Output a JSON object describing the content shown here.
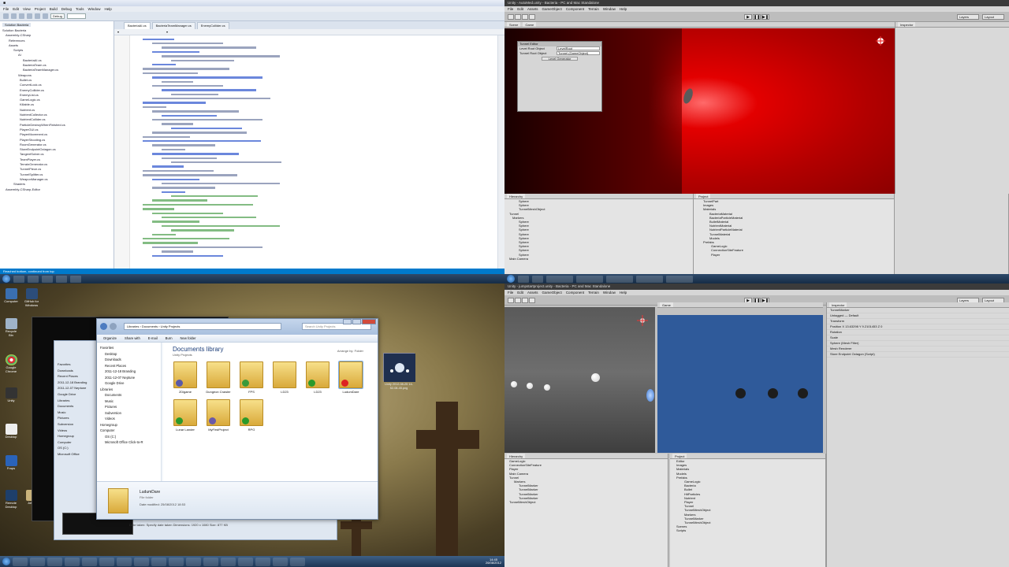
{
  "quadrants": {
    "visual_studio": {
      "solution_tabs": [
        "Solution Bacteria"
      ],
      "solution_tree": [
        "Solution Bacteria",
        "Assembly-CSharp",
        "References",
        "Assets",
        "Scripts",
        "AI",
        "BacteriaAI.cs",
        "BacteriaTeam.cs",
        "BacteriaTeamManager.cs",
        "Weapons",
        "Bullet.cs",
        "ConvertLock.cs",
        "EnemyCollider.cs",
        "EnemyList.cs",
        "GameLogic.cs",
        "Killable.cs",
        "Nutrient.cs",
        "NutrientCollector.cs",
        "NutrientCollider.cs",
        "ParticleDestroyWhenFinished.cs",
        "PlayerGUI.cs",
        "PlayerMovement.cs",
        "PlayerShooting.cs",
        "RoomGenerator.cs",
        "StoreEndpointOctagon.cs",
        "TangentSolver.cs",
        "TeamPlayer.cs",
        "TerrainGenerator.cs",
        "TunnelPiece.cs",
        "TunnelSplitter.cs",
        "WeaponManager.cs",
        "Shaders",
        "Assembly-CSharp-Editor"
      ],
      "editor_tabs": [
        "BacteriaAI.cs",
        "BacteriaTeamManager.cs",
        "EnemyCollider.cs"
      ],
      "status": "Reached bottom, continued from top"
    },
    "unity_game": {
      "title": "Unity - AutoMed.unity - Bacteria - PC and Mac Standalone",
      "menu": [
        "File",
        "Edit",
        "Assets",
        "GameObject",
        "Component",
        "Terrain",
        "Window",
        "Help"
      ],
      "scene_tabs": [
        "Scene",
        "Game"
      ],
      "inspector_tab": "Inspector",
      "tunnel_editor": {
        "title": "Tunnel Editor",
        "rows": [
          {
            "label": "Level Root Object",
            "value": "LevelRoot"
          },
          {
            "label": "Tunnel Root Object",
            "value": "Tunnel (GameObject)"
          }
        ],
        "button": "Level Generator"
      },
      "hierarchy_tab": "Hierarchy",
      "project_tab": "Project",
      "hierarchy_items": [
        "Sphere",
        "Sphere",
        "TunnelMeshObject",
        "Tunnel",
        "Markers",
        "Sphere",
        "Sphere",
        "Sphere",
        "Sphere",
        "Sphere",
        "Sphere",
        "Sphere",
        "Sphere",
        "Sphere",
        "Main Camera"
      ],
      "project_items": [
        "TunnelPart",
        "Images",
        "Materials",
        "BacteriaMaterial",
        "BacteriaParticleMaterial",
        "BulletMaterial",
        "NutrientMaterial",
        "NutrientParticleMaterial",
        "TunnelMaterial",
        "Models",
        "Prefabs",
        "GameLogic",
        "ConnectionSiteFeature",
        "Player"
      ]
    },
    "desktop": {
      "explorer": {
        "address": "Libraries › Documents › Unity Projects",
        "search_placeholder": "Search Unity Projects",
        "commands": [
          "Organize",
          "Share with",
          "E-mail",
          "Burn",
          "New folder"
        ],
        "library_title": "Documents library",
        "library_sub": "Unity Projects",
        "arrange": "Arrange by: Folder",
        "nav_items": [
          "Favorites",
          "Desktop",
          "Downloads",
          "Recent Places",
          "2011-12-18 Branding",
          "2011-12-07 Neptune",
          "Google Drive",
          "Libraries",
          "Documents",
          "Music",
          "Pictures",
          "Subversion",
          "Videos",
          "Homegroup",
          "Computer",
          "OS (C:)",
          "Microsoft Office Click-to-R"
        ],
        "folders": [
          "2Digame",
          "Dungeon Crawler",
          "FPS",
          "LD23",
          "LD23",
          "LudumDare",
          "Lunar Lander",
          "MyFirstProject",
          "RPG"
        ],
        "details": {
          "name": "LudumDare",
          "type": "File folder",
          "modified": "Date modified: 25/08/2012 18:53",
          "tags": "Date taken: Specify date taken  Dimensions: 1920 x 1080  Size: 877 KB"
        }
      },
      "back_explorer_nav": [
        "Favorites",
        "Downloads",
        "Recent Places",
        "2011-12-18 Branding",
        "2011-12-07 Neptune",
        "Google Drive",
        "Libraries",
        "Documents",
        "Music",
        "Pictures",
        "Subversion",
        "Videos",
        "Homegroup",
        "Computer",
        "OS (C:)",
        "Microsoft Office"
      ],
      "thumbnail_label": "Unity 2012-08-25 14-52-08-45.png",
      "desktop_icons": [
        "Computer",
        "GitHub for Windows",
        "Recycle Bin",
        "Google Chrome",
        "Unity",
        "Desktop",
        "Fraps",
        "Remote Desktop",
        "Jotter"
      ],
      "clock": "14:45\n26/08/2012"
    },
    "unity_scene": {
      "title": "Unity - jumpstartproject.unity - Bacteria - PC and Mac Standalone",
      "inspector": {
        "object": "TunnelMarker",
        "tag": "Untagged",
        "layer": "Default",
        "rows": [
          "Transform",
          "Position  X 13.63298  Y 9.2101453  Z 0",
          "Rotation",
          "Scale",
          "Sphere (Mesh Filter)",
          "Mesh Renderer",
          "Store Endpoint Octagon (Script)"
        ]
      },
      "hierarchy_items": [
        "GameLogic",
        "ConnectionSiteFeature",
        "Player",
        "Main Camera",
        "Tunnel",
        "Markers",
        "TunnelMarker",
        "TunnelMarker",
        "TunnelMarker",
        "TunnelMarker",
        "TunnelMeshObject"
      ],
      "project_items": [
        "Editor",
        "Images",
        "Materials",
        "Models",
        "Prefabs",
        "GameLogic",
        "Bacteria",
        "Bullet",
        "HitParticles",
        "Nutrient",
        "Player",
        "Tunnel",
        "TunnelMeshObject",
        "Markers",
        "TunnelMarker",
        "TunnelMeshObject",
        "Scenes",
        "Scripts"
      ]
    }
  },
  "colors": {
    "vs_status": "#007acc",
    "red_scene": "#c10000",
    "blue_scene": "#2f5a9a"
  }
}
